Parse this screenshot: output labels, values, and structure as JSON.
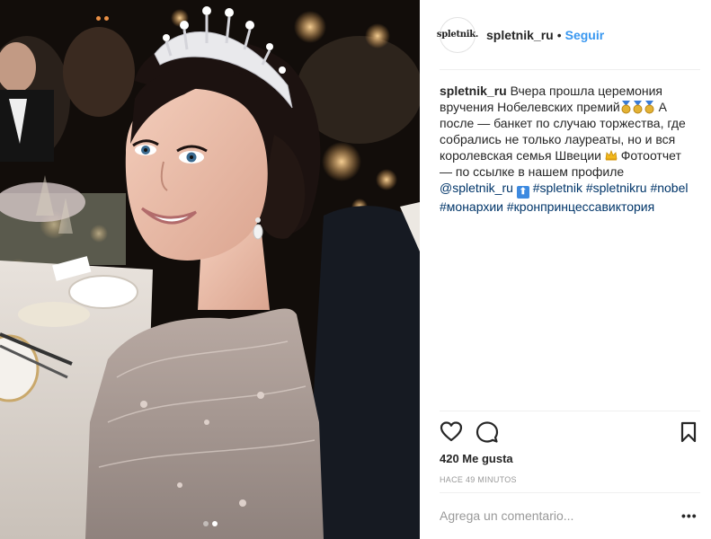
{
  "post": {
    "username": "spletnik_ru",
    "separator": "•",
    "follow_label": "Seguir",
    "avatar_text": "spletnik."
  },
  "caption": {
    "username": "spletnik_ru",
    "text_1": "Вчера прошла церемония вручения Нобелевских премий",
    "text_2": " А после — банкет по случаю торжества, где собрались не только лауреаты, но и вся королевская семья Швеции ",
    "text_3": " Фотоотчет — по ссылке в нашем профиле ",
    "mention": "@spletnik_ru",
    "arrow_glyph": "⬆",
    "hashtags": [
      "#spletnik",
      "#spletnikru",
      "#nobel",
      "#монархии",
      "#кронпринцессавиктория"
    ]
  },
  "stats": {
    "likes": "420 Me gusta",
    "time": "HACE 49 MINUTOS"
  },
  "comment": {
    "placeholder": "Agrega un comentario...",
    "more_glyph": "•••"
  },
  "icons": [
    "heart-icon",
    "comment-icon",
    "bookmark-icon",
    "medal-icon",
    "crown-icon",
    "more-icon"
  ],
  "colors": {
    "link": "#3897f0",
    "hashtag": "#003569",
    "meta": "#999999",
    "border": "#efefef"
  }
}
